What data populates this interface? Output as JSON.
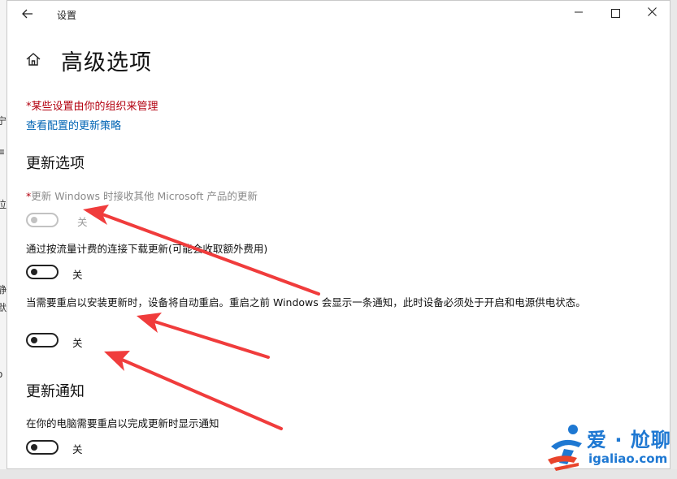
{
  "window": {
    "app_title": "设置"
  },
  "background_window": {
    "fragments": [
      "宁",
      "≡",
      "位",
      "静",
      "默",
      "o"
    ]
  },
  "page": {
    "title": "高级选项",
    "managed_note": "*某些设置由你的组织来管理",
    "policy_link": "查看配置的更新策略"
  },
  "section_update_options": {
    "title": "更新选项",
    "options": [
      {
        "required_mark": "*",
        "label": "更新 Windows 时接收其他 Microsoft 产品的更新",
        "state": "关",
        "enabled": false
      },
      {
        "label": "通过按流量计费的连接下载更新(可能会收取额外费用)",
        "state": "关",
        "enabled": true
      },
      {
        "label": "当需要重启以安装更新时，设备将自动重启。重启之前 Windows 会显示一条通知，此时设备必须处于开启和电源供电状态。",
        "state": "关",
        "enabled": true
      }
    ]
  },
  "section_update_notifications": {
    "title": "更新通知",
    "options": [
      {
        "label": "在你的电脑需要重启以完成更新时显示通知",
        "state": "关",
        "enabled": true
      }
    ]
  },
  "annotation": {
    "arrow_color": "#f03c3c"
  },
  "watermark": {
    "title": "爱 · 尬聊",
    "url": "igaliao.com",
    "brand_color": "#1e78d2",
    "accent_color": "#e8442c"
  }
}
